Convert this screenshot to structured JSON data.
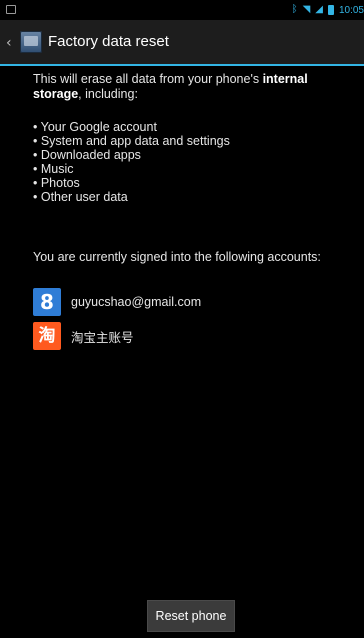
{
  "status_bar": {
    "time": "10:05",
    "icons": [
      "left-notification-icon",
      "bluetooth-icon",
      "wifi-icon",
      "signal-icon",
      "battery-icon"
    ],
    "accent_color": "#33b5e5"
  },
  "action_bar": {
    "title": "Factory data reset",
    "up_icon": "back-caret-icon",
    "app_icon": "settings-app-icon",
    "accent_color": "#33b5e5",
    "bg_color": "#1d1d1d"
  },
  "content": {
    "intro_pre": "This will erase all data from your phone's ",
    "intro_bold": "internal storage",
    "intro_post": ", including:",
    "bullets": [
      "• Your Google account",
      "• System and app data and settings",
      "• Downloaded apps",
      "• Music",
      "• Photos",
      "• Other user data"
    ],
    "signed_in_text": "You are currently signed into the following accounts:",
    "accounts": [
      {
        "icon": "google-icon",
        "icon_glyph": "8",
        "label": "guyucshao@gmail.com",
        "color": "#2f7dd6"
      },
      {
        "icon": "taobao-icon",
        "icon_glyph": "淘",
        "label": "淘宝主账号",
        "color": "#ff5a1f"
      }
    ]
  },
  "reset_button": {
    "label": "Reset phone"
  }
}
